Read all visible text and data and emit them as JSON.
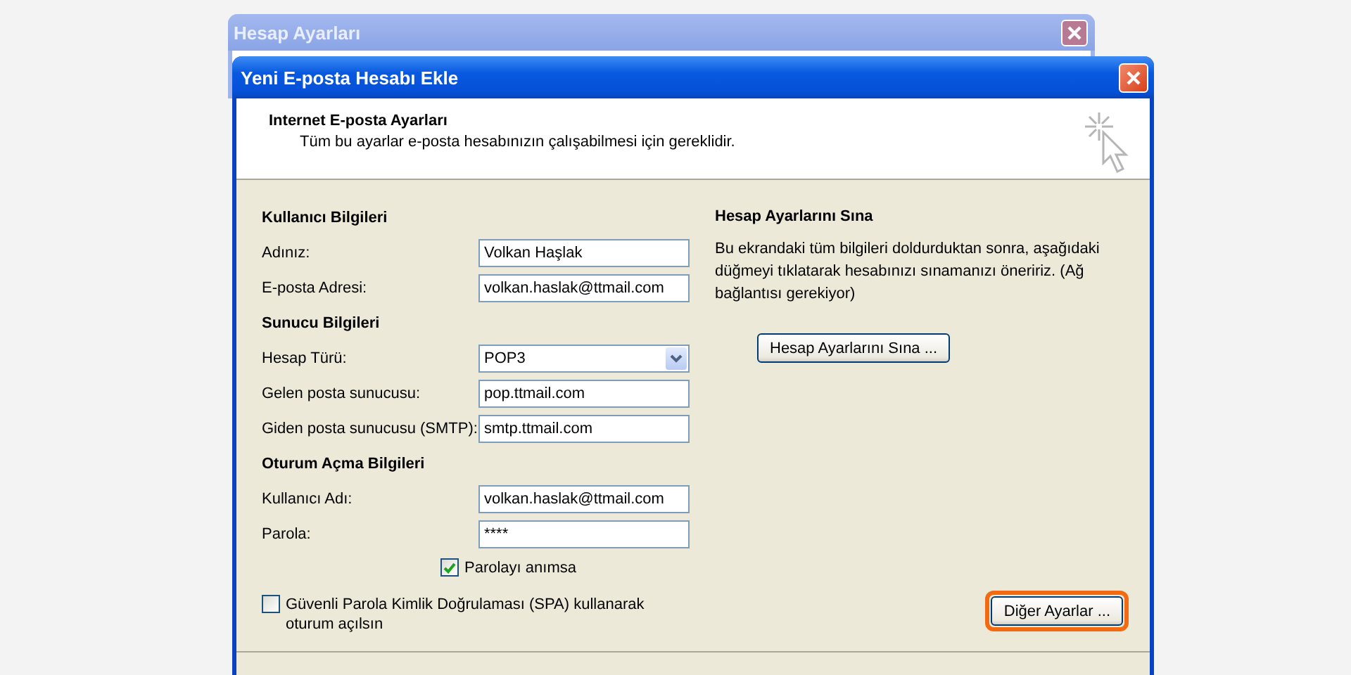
{
  "background_window": {
    "title": "Hesap Ayarları"
  },
  "dialog": {
    "title": "Yeni E-posta Hesabı Ekle",
    "header": {
      "title": "Internet E-posta Ayarları",
      "subtitle": "Tüm bu ayarlar e-posta hesabınızın çalışabilmesi için gereklidir."
    },
    "sections": [
      {
        "title": "Kullanıcı Bilgileri",
        "fields": [
          {
            "kind": "text",
            "label": "Adınız:",
            "value": "Volkan Haşlak"
          },
          {
            "kind": "text",
            "label": "E-posta Adresi:",
            "value": "volkan.haslak@ttmail.com"
          }
        ]
      },
      {
        "title": "Sunucu Bilgileri",
        "fields": [
          {
            "kind": "dropdown",
            "label": "Hesap Türü:",
            "value": "POP3"
          },
          {
            "kind": "text",
            "label": "Gelen posta sunucusu:",
            "value": "pop.ttmail.com"
          },
          {
            "kind": "text",
            "label": "Giden posta sunucusu (SMTP):",
            "value": "smtp.ttmail.com"
          }
        ]
      },
      {
        "title": "Oturum Açma Bilgileri",
        "fields": [
          {
            "kind": "text",
            "label": "Kullanıcı Adı:",
            "value": "volkan.haslak@ttmail.com"
          },
          {
            "kind": "password",
            "label": "Parola:",
            "value": "****"
          }
        ]
      }
    ],
    "remember_password": {
      "label": "Parolayı anımsa",
      "checked": true
    },
    "spa": {
      "label": "Güvenli Parola Kimlik Doğrulaması (SPA) kullanarak oturum açılsın",
      "checked": false
    },
    "test": {
      "title": "Hesap Ayarlarını Sına",
      "description": "Bu ekrandaki tüm bilgileri doldurduktan sonra, aşağıdaki düğmeyi tıklatarak hesabınızı sınamanızı öneririz. (Ağ bağlantısı gerekiyor)",
      "button": "Hesap Ayarlarını Sına ..."
    },
    "more_settings": {
      "label": "Diğer Ayarlar ...",
      "highlighted": true
    }
  }
}
